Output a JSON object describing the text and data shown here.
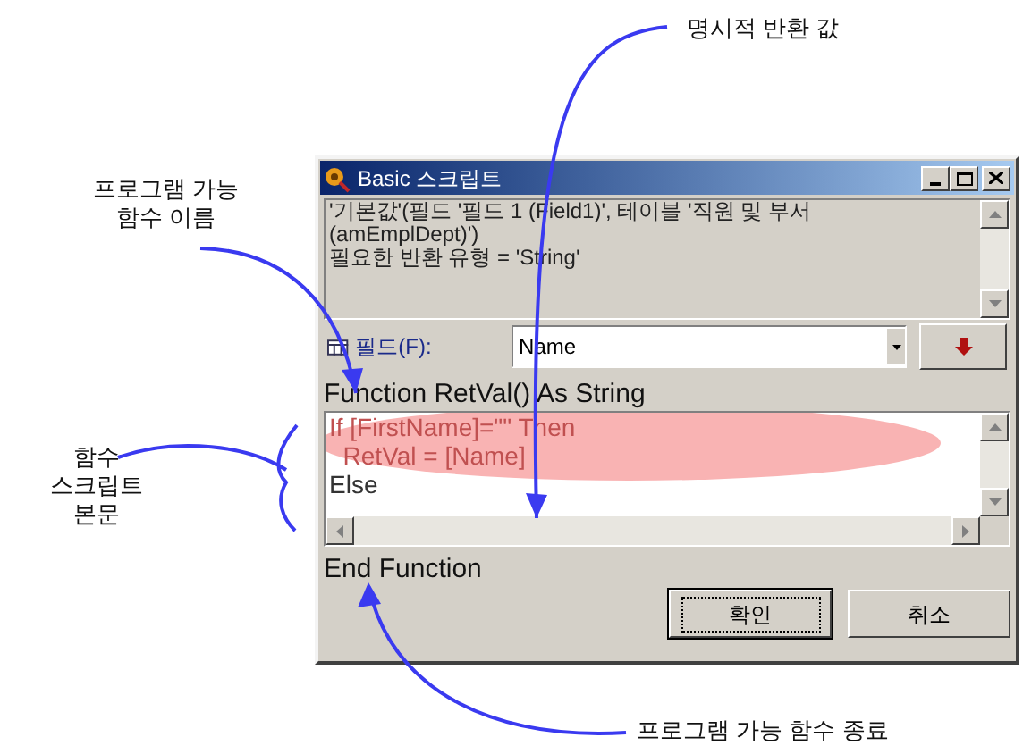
{
  "annotations": [
    {
      "kind": "top",
      "lines": [
        "명시적 반환 값"
      ]
    },
    {
      "kind": "name",
      "lines": [
        "프로그램 가능",
        "함수 이름"
      ]
    },
    {
      "kind": "body",
      "lines": [
        "함수",
        "스크립트",
        "본문"
      ]
    },
    {
      "kind": "end",
      "lines": [
        "프로그램 가능 함수 종료"
      ]
    }
  ],
  "window": {
    "title": "Basic 스크립트"
  },
  "message_lines": [
    "'기본값'(필드 '필드 1 (Field1)', 테이블 '직원 및 부서",
    "(amEmplDept)')",
    "필요한 반환 유형 = 'String'"
  ],
  "field": {
    "label": "필드(F):",
    "value": "Name"
  },
  "function_header": "Function RetVal() As String",
  "code_lines": [
    {
      "text": "If [FirstName]=\"\" Then",
      "highlighted": true
    },
    {
      "text": "  RetVal = [Name]",
      "highlighted": true
    },
    {
      "text": "Else",
      "highlighted": false
    }
  ],
  "function_footer": "End Function",
  "buttons": [
    {
      "label": "확인",
      "default": true
    },
    {
      "label": "취소",
      "default": false
    }
  ]
}
